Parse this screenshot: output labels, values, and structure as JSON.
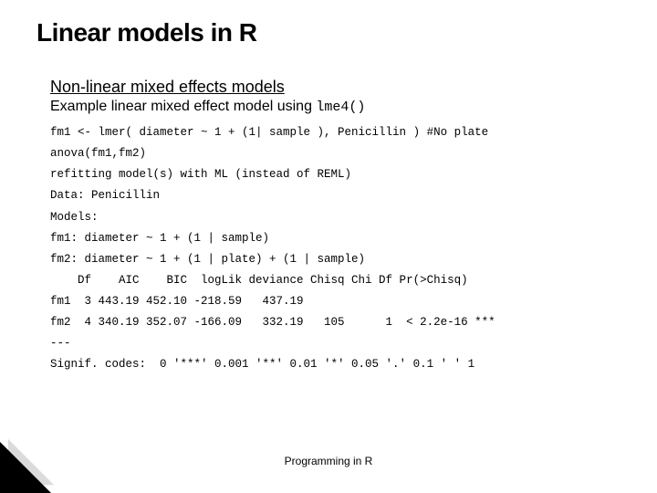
{
  "title": "Linear models in R",
  "subhead": "Non-linear mixed effects models",
  "desc_prefix": "Example linear mixed effect model using ",
  "desc_code": "lme4()",
  "code": "fm1 <- lmer( diameter ~ 1 + (1| sample ), Penicillin ) #No plate\nanova(fm1,fm2)\nrefitting model(s) with ML (instead of REML)\nData: Penicillin\nModels:\nfm1: diameter ~ 1 + (1 | sample)\nfm2: diameter ~ 1 + (1 | plate) + (1 | sample)\n    Df    AIC    BIC  logLik deviance Chisq Chi Df Pr(>Chisq)\nfm1  3 443.19 452.10 -218.59   437.19\nfm2  4 340.19 352.07 -166.09   332.19   105      1  < 2.2e-16 ***\n---\nSignif. codes:  0 '***' 0.001 '**' 0.01 '*' 0.05 '.' 0.1 ' ' 1",
  "footer": "Programming in R"
}
